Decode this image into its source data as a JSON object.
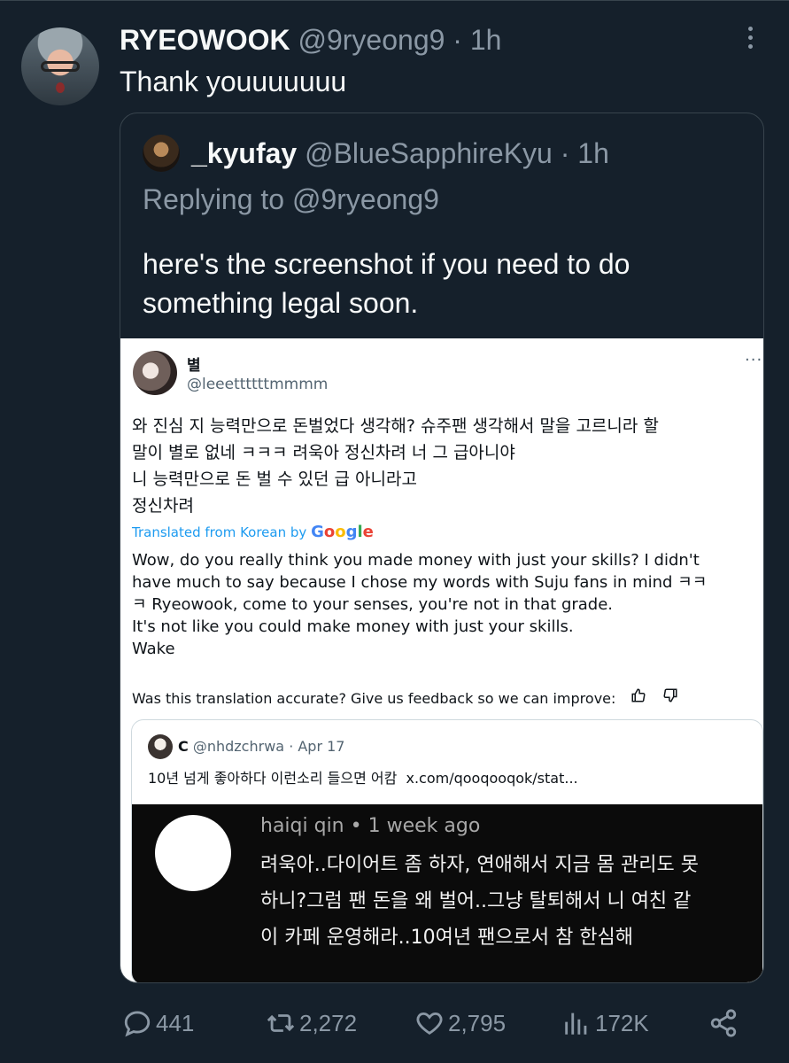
{
  "tweet": {
    "name": "RYEOWOOK",
    "handle": "@9ryeong9",
    "time": "1h",
    "text": "Thank youuuuuuu"
  },
  "quoted": {
    "name": "_kyufay",
    "handle": "@BlueSapphireKyu",
    "time": "1h",
    "replying_to": "Replying to @9ryeong9",
    "text_lines": [
      "here's the screenshot if you need to do",
      "something legal soon."
    ]
  },
  "screenshot": {
    "name": "별",
    "handle": "@leeettttttmmmm",
    "more": "···",
    "korean_lines": [
      "와 진심 지 능력만으로 돈벌었다 생각해? 슈주팬 생각해서 말을 고르니라 할",
      "말이 별로 없네 ㅋㅋㅋ 려욱아 정신차려 너 그 급아니야",
      "니 능력만으로 돈 벌 수 있던 급 아니라고",
      "정신차려"
    ],
    "translated_label": "Translated from Korean by",
    "google": [
      "G",
      "o",
      "o",
      "g",
      "l",
      "e"
    ],
    "english_lines": [
      "Wow, do you really think you made money with just your skills? I didn't",
      "have much to say because I chose my words with Suju fans in mind ㅋㅋ",
      "ㅋ Ryeowook, come to your senses, you're not in that grade.",
      "It's not like you could make money with just your skills.",
      "Wake"
    ],
    "feedback": "Was this translation accurate? Give us feedback so we can improve:",
    "inner_quote": {
      "name": "C",
      "handle": "@nhdzchrwa",
      "date": "Apr 17",
      "text": "10년 넘게 좋아하다 이런소리 들으면 어캄",
      "link": "x.com/qooqooqok/stat...",
      "comment": {
        "author": "haiqi qin",
        "time": "1 week ago",
        "lines": [
          "려욱아..다이어트 좀 하자, 연애해서 지금 몸 관리도 못",
          "하니?그럼 팬 돈을 왜 벌어..그냥 탈퇴해서 니 여친 같",
          "이 카페 운영해라..10여년 팬으로서 참 한심해"
        ]
      }
    }
  },
  "actions": {
    "replies": "441",
    "retweets": "2,272",
    "likes": "2,795",
    "views": "172K"
  },
  "icons": [
    "more-icon",
    "reply-icon",
    "retweet-icon",
    "like-icon",
    "views-icon",
    "share-icon",
    "thumbs-up-icon",
    "thumbs-down-icon"
  ]
}
